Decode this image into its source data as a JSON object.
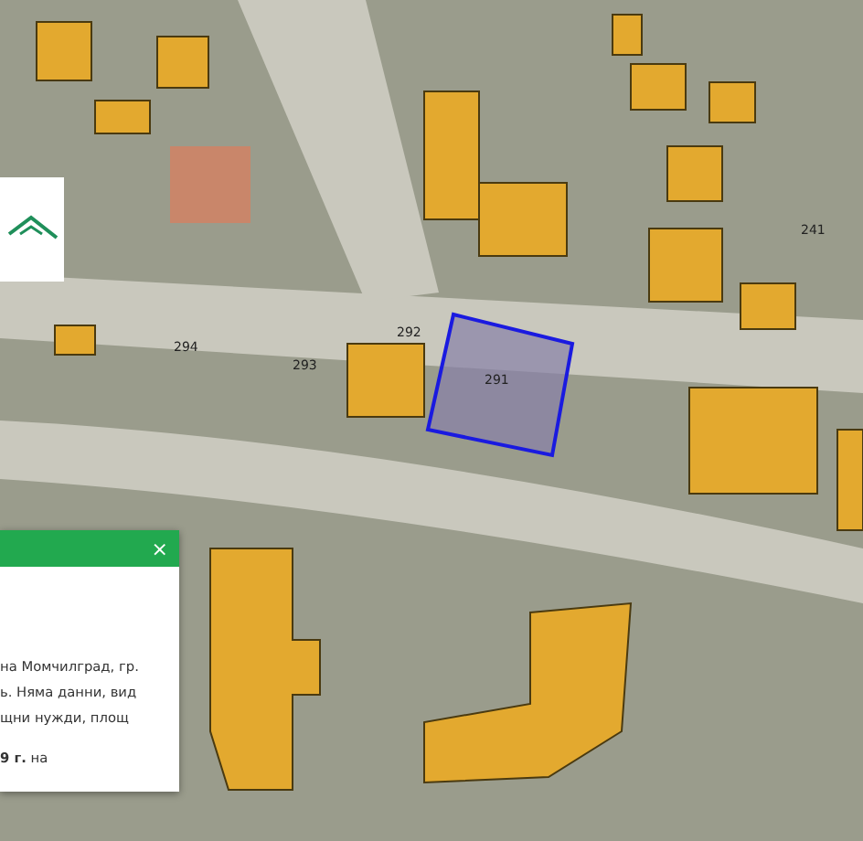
{
  "map": {
    "parcels": [
      {
        "label": "294",
        "selected": false
      },
      {
        "label": "293",
        "selected": false
      },
      {
        "label": "292",
        "selected": false
      },
      {
        "label": "291",
        "selected": true
      },
      {
        "label": "241",
        "selected": false
      }
    ]
  },
  "popup": {
    "close": "×",
    "lines": [
      "на Момчилград, гр.",
      "ь. Няма данни, вид",
      "щни нужди, площ",
      "**9 г.** на"
    ]
  }
}
